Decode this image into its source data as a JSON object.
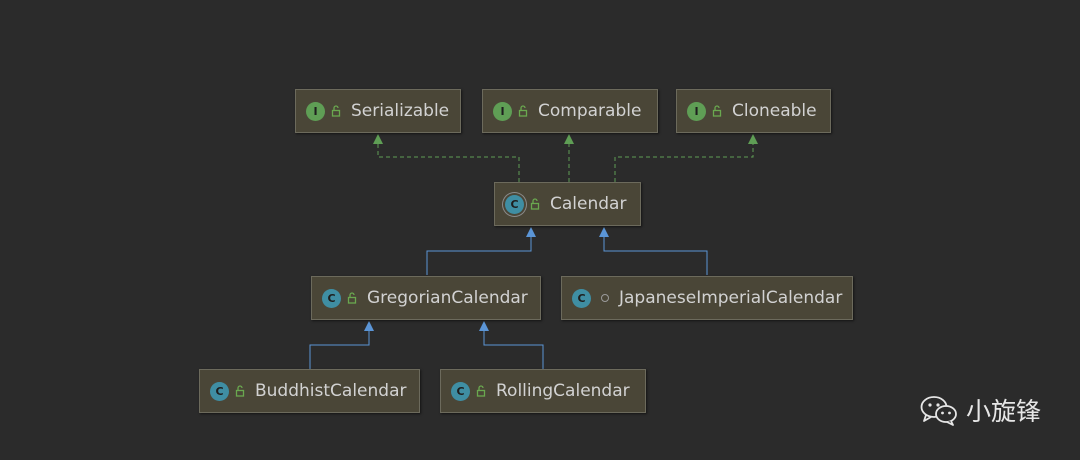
{
  "nodes": {
    "serializable": "Serializable",
    "comparable": "Comparable",
    "cloneable": "Cloneable",
    "calendar": "Calendar",
    "gregorian": "GregorianCalendar",
    "japanese": "JapaneseImperialCalendar",
    "buddhist": "BuddhistCalendar",
    "rolling": "RollingCalendar"
  },
  "badges": {
    "interface": "I",
    "class": "C"
  },
  "watermark": "小旋锋",
  "icons": {
    "interface_badge": "interface-icon",
    "class_badge": "class-icon",
    "abstract_badge": "abstract-class-icon",
    "public": "unlocked-public-icon",
    "package_private": "package-private-icon",
    "watermark": "wechat-icon"
  },
  "colors": {
    "background": "#2b2b2b",
    "node_fill": "#4a4637",
    "implements_edge": "#5f9e55",
    "extends_edge": "#5b95d6"
  }
}
